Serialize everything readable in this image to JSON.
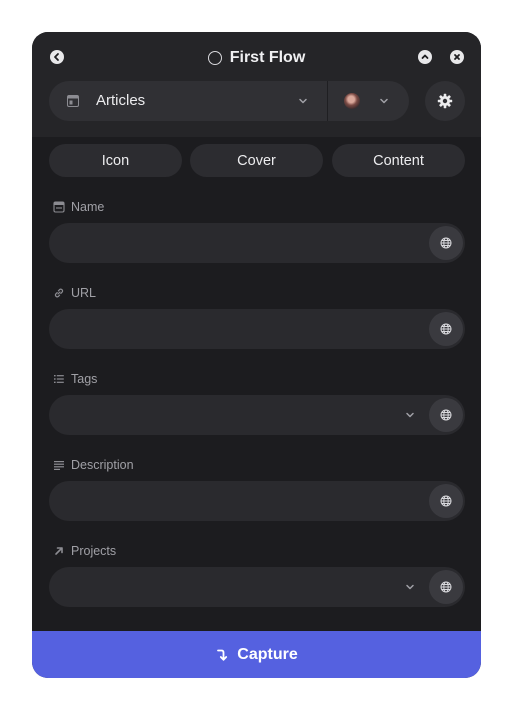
{
  "window": {
    "title": "First Flow"
  },
  "header": {
    "back_icon": "back-arrow-icon",
    "collapse_icon": "chevron-up-icon",
    "close_icon": "close-icon"
  },
  "database": {
    "label": "Articles",
    "icon": "database-table-icon"
  },
  "settings": {
    "icon": "gear-icon"
  },
  "tabs": [
    {
      "label": "Icon"
    },
    {
      "label": "Cover"
    },
    {
      "label": "Content"
    }
  ],
  "fields": [
    {
      "label": "Name",
      "icon": "title-field-icon",
      "value": "",
      "type": "text"
    },
    {
      "label": "URL",
      "icon": "link-icon",
      "value": "",
      "type": "text"
    },
    {
      "label": "Tags",
      "icon": "list-icon",
      "value": "",
      "type": "select"
    },
    {
      "label": "Description",
      "icon": "text-lines-icon",
      "value": "",
      "type": "text"
    },
    {
      "label": "Projects",
      "icon": "relation-arrow-icon",
      "value": "",
      "type": "select"
    }
  ],
  "capture": {
    "label": "Capture",
    "icon": "arrow-down-curved-icon"
  },
  "colors": {
    "accent": "#5561e0",
    "window_bg": "#1c1c1f",
    "header_bg": "#252528",
    "input_bg": "#2a2a2e"
  }
}
